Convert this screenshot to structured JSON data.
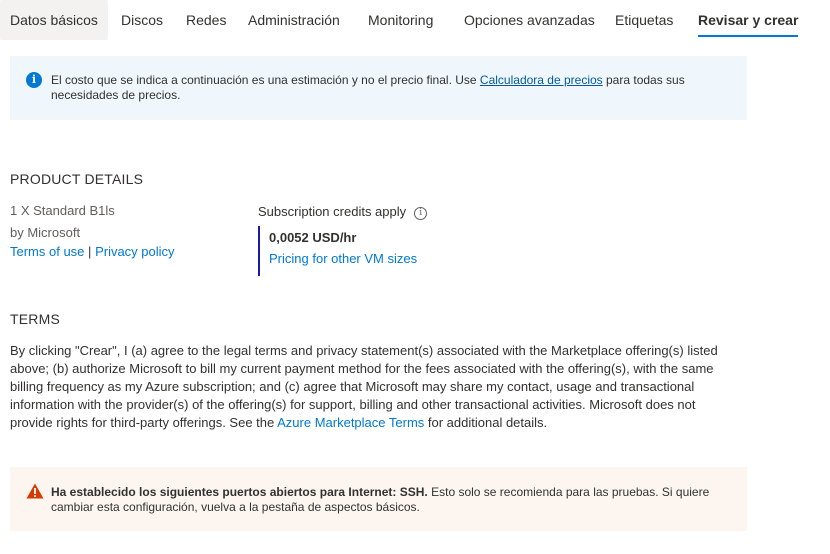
{
  "tabs": [
    {
      "label": "Datos básicos"
    },
    {
      "label": "Discos"
    },
    {
      "label": "Redes"
    },
    {
      "label": "Administración"
    },
    {
      "label": "Monitoring"
    },
    {
      "label": "Opciones avanzadas"
    },
    {
      "label": "Etiquetas"
    },
    {
      "label": "Revisar y crear"
    }
  ],
  "info": {
    "text_before": "El costo que se indica a continuación es una estimación y no el precio final. Use ",
    "link": "Calculadora de precios",
    "text_after": " para todas sus necesidades de precios.",
    "icon": "info-icon",
    "color": "#0078d4"
  },
  "product": {
    "section_title": "PRODUCT DETAILS",
    "name": "1 X Standard B1ls",
    "publisher": "by Microsoft",
    "terms_link": "Terms of use",
    "separator": "|",
    "privacy_link": "Privacy policy",
    "credits_label": "Subscription credits apply",
    "credits_icon": "info-circle-icon",
    "price": "0,0052 USD/hr",
    "pricing_link": "Pricing for other VM sizes"
  },
  "terms": {
    "section_title": "TERMS",
    "text": "By clicking \"Crear\", I (a) agree to the legal terms and privacy statement(s) associated with the Marketplace offering(s) listed above; (b) authorize Microsoft to bill my current payment method for the fees associated with the offering(s), with the same billing frequency as my Azure subscription; and (c) agree that Microsoft may share my contact, usage and transactional information with the provider(s) of the offering(s) for support, billing and other transactional activities. Microsoft does not provide rights for third-party offerings. See the ",
    "link": "Azure Marketplace Terms",
    "text_after": " for additional details."
  },
  "warning": {
    "bold": "Ha establecido los siguientes puertos abiertos para Internet: SSH.",
    "text": "  Esto solo se recomienda para las pruebas.  Si quiere cambiar esta configuración, vuelva a la pestaña de aspectos básicos.",
    "icon": "warning-icon",
    "color": "#d83b01"
  },
  "colors": {
    "accent": "#0078d4",
    "info_bg": "#eff6fc",
    "warning_bg": "#fdf6f0",
    "price_border": "#1a1aa8"
  }
}
